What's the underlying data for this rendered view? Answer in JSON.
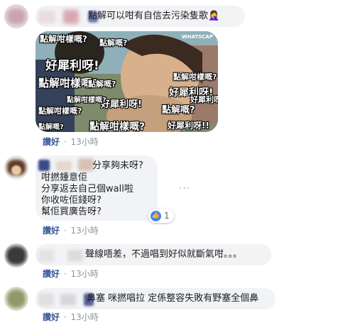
{
  "comments": [
    {
      "text_lines": [
        "點解可以咁有自信去污染隻歌🤦‍♀️"
      ],
      "like_label": "讚好",
      "time": "13小時",
      "media": {
        "watermark": "WHATSCAP",
        "overlay_texts": [
          "點解咁樣嘅?",
          "點解嘅?",
          "好犀利呀!",
          "點解咁樣嘅?",
          "點解咁樣嘅?",
          "好犀利呀!",
          "點解嘅?",
          "好犀利呀!",
          "點解咁樣嘅?",
          "點解嘅?",
          "好犀利呀!!!",
          "點解咁樣嘅?",
          "點解嘅?",
          "點解咁樣嘅?",
          "好犀利呀!!"
        ]
      }
    },
    {
      "text_lines": [
        "分享夠未呀?",
        "咁撚鍾意佢",
        "分享返去自己個wall啦",
        "你收咗佢錢呀?",
        "幫佢買廣告呀?"
      ],
      "like_label": "讚好",
      "time": "13小時",
      "reaction_count": "1",
      "more_label": "···"
    },
    {
      "text_lines": [
        "聲線唔差，不過唱到好似就斷氣咁。。。"
      ],
      "like_label": "讚好",
      "time": "13小時"
    },
    {
      "text_lines": [
        "鼻塞  咪撚唱拉  定係整容失敗有野塞全個鼻"
      ],
      "like_label": "讚好",
      "time": "13小時"
    }
  ],
  "separator": "·",
  "colors": {
    "bubble": "#f2f3f5",
    "link": "#385898",
    "meta": "#90949c",
    "like_blue": "#4080ff"
  }
}
